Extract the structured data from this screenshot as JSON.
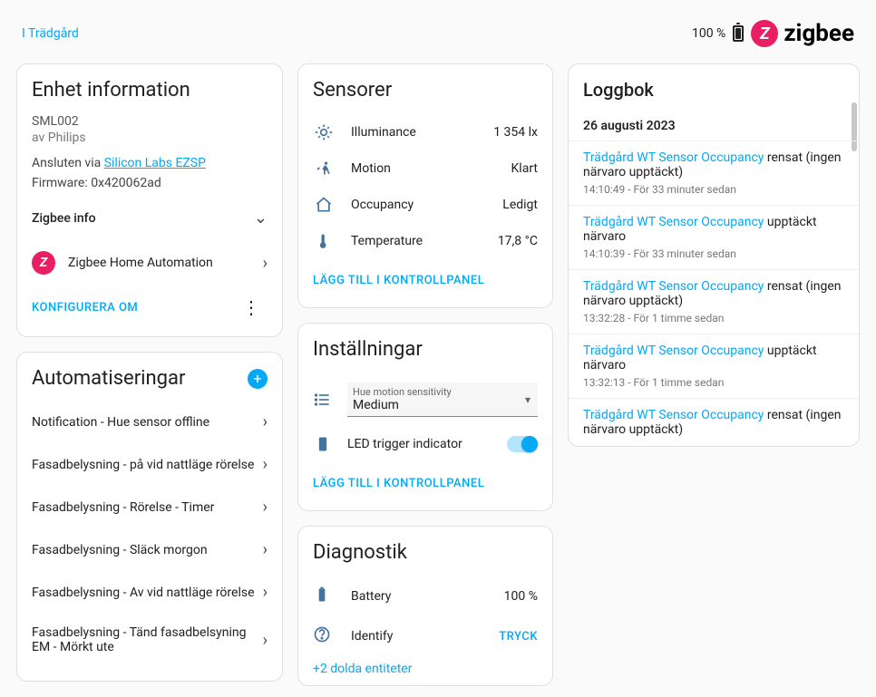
{
  "header": {
    "breadcrumb": "I Trädgård",
    "battery_pct": "100 %",
    "brand": "zigbee"
  },
  "deviceInfo": {
    "title": "Enhet information",
    "model": "SML002",
    "by_prefix": "av ",
    "manufacturer": "Philips",
    "connected_prefix": "Ansluten via ",
    "integration_link": "Silicon Labs EZSP",
    "firmware_label": "Firmware: ",
    "firmware": "0x420062ad",
    "zigbee_info": "Zigbee info",
    "zha": "Zigbee Home Automation",
    "reconfigure": "KONFIGURERA OM"
  },
  "automations": {
    "title": "Automatiseringar",
    "items": [
      "Notification - Hue sensor offline",
      "Fasadbelysning - på vid nattläge rörelse",
      "Fasadbelysning - Rörelse - Timer",
      "Fasadbelysning - Släck morgon",
      "Fasadbelysning - Av vid nattläge rörelse",
      "Fasadbelysning - Tänd fasadbelsyning EM - Mörkt ute"
    ]
  },
  "sensors": {
    "title": "Sensorer",
    "rows": [
      {
        "name": "Illuminance",
        "value": "1 354 lx",
        "icon": "brightness"
      },
      {
        "name": "Motion",
        "value": "Klart",
        "icon": "motion"
      },
      {
        "name": "Occupancy",
        "value": "Ledigt",
        "icon": "home"
      },
      {
        "name": "Temperature",
        "value": "17,8 °C",
        "icon": "thermometer"
      }
    ],
    "footer": "LÄGG TILL I KONTROLLPANEL"
  },
  "settings": {
    "title": "Inställningar",
    "sensitivity_label": "Hue motion sensitivity",
    "sensitivity_value": "Medium",
    "led_label": "LED trigger indicator",
    "led_on": true,
    "footer": "LÄGG TILL I KONTROLLPANEL"
  },
  "diagnostics": {
    "title": "Diagnostik",
    "battery_name": "Battery",
    "battery_value": "100 %",
    "identify_name": "Identify",
    "identify_action": "TRYCK",
    "hidden": "+2 dolda entiteter"
  },
  "logbook": {
    "title": "Loggbok",
    "date": "26 augusti 2023",
    "device_name": "Trädgård WT Sensor Occupancy",
    "entries": [
      {
        "suffix": " rensat (ingen närvaro upptäckt)",
        "time": "14:10:49 - För 33 minuter sedan"
      },
      {
        "suffix": " upptäckt närvaro",
        "time": "14:10:39 - För 33 minuter sedan"
      },
      {
        "suffix": " rensat (ingen närvaro upptäckt)",
        "time": "13:32:28 - För 1 timme sedan"
      },
      {
        "suffix": " upptäckt närvaro",
        "time": "13:32:13 - För 1 timme sedan"
      },
      {
        "suffix": " rensat (ingen närvaro upptäckt)",
        "time": ""
      }
    ]
  }
}
